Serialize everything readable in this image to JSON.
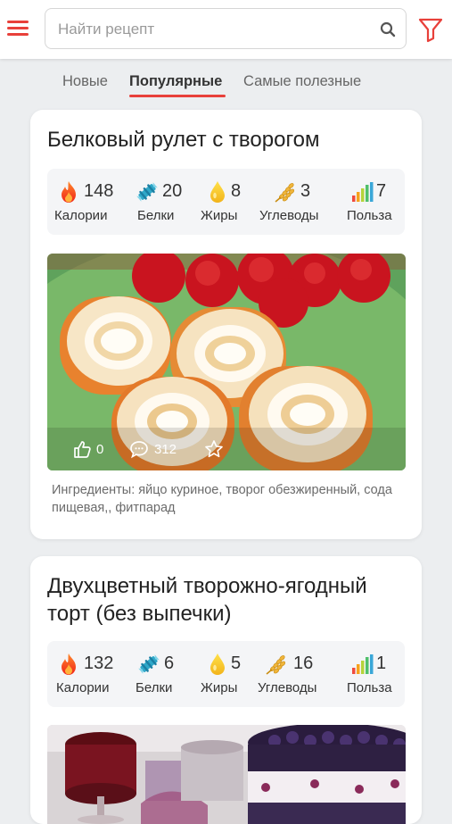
{
  "search": {
    "placeholder": "Найти рецепт"
  },
  "tabs": [
    {
      "label": "Новые"
    },
    {
      "label": "Популярные",
      "active": true
    },
    {
      "label": "Самые полезные"
    }
  ],
  "accent_color": "#e8403a",
  "recipes": [
    {
      "title": "Белковый рулет с творогом",
      "stats": [
        {
          "icon": "flame-icon",
          "value": "148",
          "label": "Калории"
        },
        {
          "icon": "protein-icon",
          "value": "20",
          "label": "Белки"
        },
        {
          "icon": "drop-icon",
          "value": "8",
          "label": "Жиры"
        },
        {
          "icon": "wheat-icon",
          "value": "3",
          "label": "Углеводы"
        },
        {
          "icon": "benefit-bars-icon",
          "value": "7",
          "label": "Польза"
        }
      ],
      "likes": "0",
      "comments": "312",
      "ingredients": "Ингредиенты: яйцо куриное, творог обезжиренный, сода пищевая,, фитпарад"
    },
    {
      "title": "Двухцветный творожно-ягодный торт (без выпечки)",
      "stats": [
        {
          "icon": "flame-icon",
          "value": "132",
          "label": "Калории"
        },
        {
          "icon": "protein-icon",
          "value": "6",
          "label": "Белки"
        },
        {
          "icon": "drop-icon",
          "value": "5",
          "label": "Жиры"
        },
        {
          "icon": "wheat-icon",
          "value": "16",
          "label": "Углеводы"
        },
        {
          "icon": "benefit-bars-icon",
          "value": "1",
          "label": "Польза"
        }
      ]
    }
  ]
}
